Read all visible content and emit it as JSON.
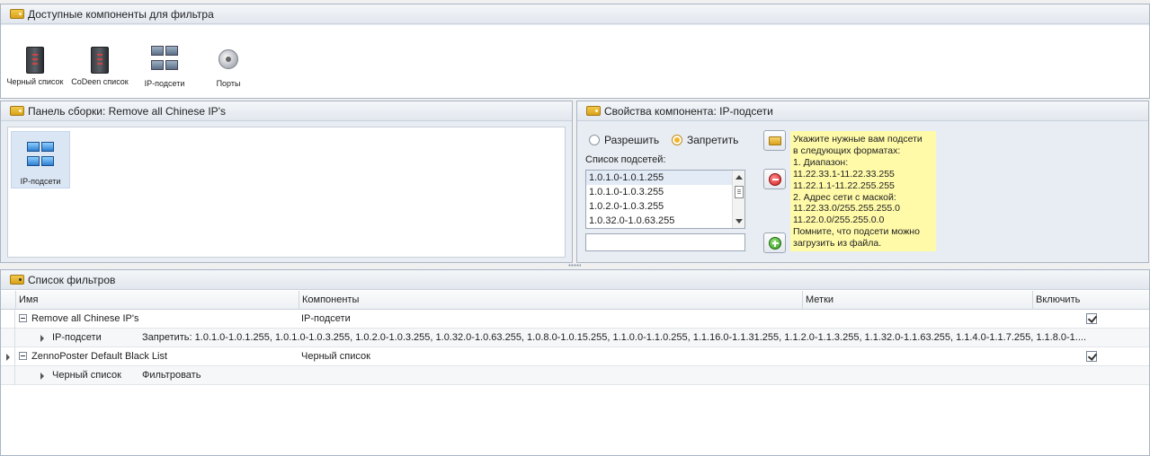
{
  "components_panel": {
    "title": "Доступные компоненты для фильтра",
    "items": [
      {
        "label": "Черный список",
        "icon": "black-list-icon"
      },
      {
        "label": "CoDeen список",
        "icon": "codeen-list-icon"
      },
      {
        "label": "IP-подсети",
        "icon": "ip-subnets-icon"
      },
      {
        "label": "Порты",
        "icon": "ports-icon"
      }
    ]
  },
  "assembly_panel": {
    "title": "Панель сборки: Remove all Chinese IP's",
    "items": [
      {
        "label": "IP-подсети",
        "icon": "ip-subnets-icon"
      }
    ]
  },
  "properties_panel": {
    "title": "Свойства компонента: IP-подсети",
    "radio_allow": "Разрешить",
    "radio_deny": "Запретить",
    "selected_mode": "Запретить",
    "subnet_list_label": "Список подсетей:",
    "subnets": [
      "1.0.1.0-1.0.1.255",
      "1.0.1.0-1.0.3.255",
      "1.0.2.0-1.0.3.255",
      "1.0.32.0-1.0.63.255"
    ],
    "input_value": "",
    "hint_lines": [
      "Укажите нужные вам подсети",
      "в следующих форматах:",
      "1. Диапазон:",
      "11.22.33.1-11.22.33.255",
      "11.22.1.1-11.22.255.255",
      "2. Адрес сети с маской:",
      "11.22.33.0/255.255.255.0",
      "11.22.0.0/255.255.0.0",
      "Помните, что подсети можно",
      "загрузить из файла."
    ]
  },
  "filters_panel": {
    "title": "Список фильтров",
    "columns": [
      "Имя",
      "Компоненты",
      "Метки",
      "Включить"
    ],
    "filters": [
      {
        "name": "Remove all Chinese IP's",
        "components": "IP-подсети",
        "tags": "",
        "enabled": true,
        "child": {
          "name": "IP-подсети",
          "value": "Запретить: 1.0.1.0-1.0.1.255, 1.0.1.0-1.0.3.255, 1.0.2.0-1.0.3.255, 1.0.32.0-1.0.63.255, 1.0.8.0-1.0.15.255, 1.1.0.0-1.1.0.255, 1.1.16.0-1.1.31.255, 1.1.2.0-1.1.3.255, 1.1.32.0-1.1.63.255, 1.1.4.0-1.1.7.255, 1.1.8.0-1...."
        }
      },
      {
        "name": "ZennoPoster Default Black List",
        "components": "Черный список",
        "tags": "",
        "enabled": true,
        "child": {
          "name": "Черный список",
          "value": "Фильтровать"
        }
      }
    ]
  }
}
